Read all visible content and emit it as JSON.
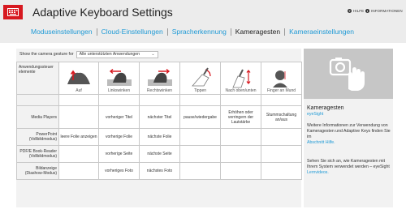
{
  "app": {
    "title": "Adaptive Keyboard Settings",
    "help_label": "HILFE",
    "info_label": "INFORMATIONEN"
  },
  "nav": {
    "tabs": [
      {
        "label": "Moduseinstellungen"
      },
      {
        "label": "Cloud-Einstellungen"
      },
      {
        "label": "Spracherkennung"
      },
      {
        "label": "Kameragesten"
      },
      {
        "label": "Kameraeinstellungen"
      }
    ]
  },
  "filter": {
    "label": "Show the camera gesture for",
    "selected": "Alle unterstützten Anwendungen"
  },
  "table": {
    "corner_label": "Anwendungssteuer elemente",
    "gestures": [
      {
        "label": "Auf",
        "icon": "hand-up-icon"
      },
      {
        "label": "Linkswinken",
        "icon": "wave-left-icon"
      },
      {
        "label": "Rechtswinken",
        "icon": "wave-right-icon"
      },
      {
        "label": "Tippen",
        "icon": "tap-icon"
      },
      {
        "label": "Nach oben/unten",
        "icon": "up-down-icon"
      },
      {
        "label": "Finger an Mund",
        "icon": "finger-mouth-icon"
      }
    ],
    "rows": [
      {
        "app": "Media Players",
        "cells": [
          "",
          "vorheriger Titel",
          "nächster Titel",
          "pause/wiedergabe",
          "Erhöhen oder verringern der Lautstärke",
          "Stummschaltung an/aus"
        ]
      },
      {
        "app": "PowerPoint (Vollbildmodus)",
        "cells": [
          "leere Folie anzeigen",
          "vorherige Folie",
          "nächste Folie",
          "",
          "",
          ""
        ]
      },
      {
        "app": "PDF/E Book-Reader (Vollbildmodus)",
        "cells": [
          "",
          "vorherige Seite",
          "nächste Seite",
          "",
          "",
          ""
        ]
      },
      {
        "app": "Bildanzeige (Diashow-Modus)",
        "cells": [
          "",
          "vorheriges Foto",
          "nächstes Foto",
          "",
          "",
          ""
        ]
      }
    ]
  },
  "side": {
    "heading": "Kameragesten",
    "brand": "eyeSight",
    "para1": "Weitere Informationen zur Verwendung von Kameragesten und Adaptive Keys finden Sie im",
    "link1": "Abschnitt Hilfe.",
    "para2": "Sehen Sie sich an, wie Kameragesten mit Ihrem System verwendet werden – eyeSight",
    "link2": "Lernvideos."
  },
  "colors": {
    "accent": "#1f9ad6",
    "brand_red": "#d71920",
    "header_bg": "#ececec",
    "panel_bg": "#f2f2f2"
  }
}
